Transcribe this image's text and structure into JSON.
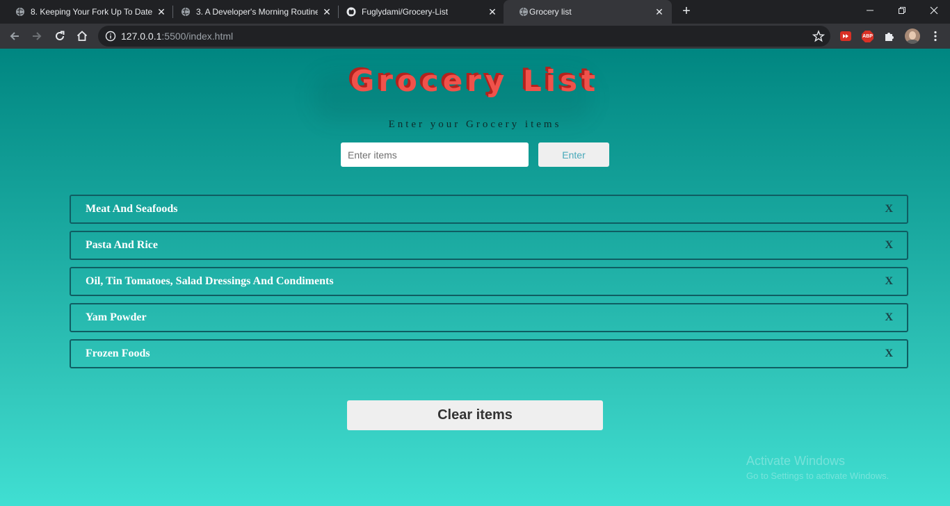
{
  "browser": {
    "tabs": [
      {
        "title": "8. Keeping Your Fork Up To Date",
        "icon": "globe-icon",
        "active": false
      },
      {
        "title": "3. A Developer's Morning Routine",
        "icon": "globe-icon",
        "active": false
      },
      {
        "title": "Fuglydami/Grocery-List",
        "icon": "github-icon",
        "active": false
      },
      {
        "title": "Grocery list",
        "icon": "globe-icon",
        "active": true
      }
    ],
    "new_tab": "+",
    "close_glyph": "✕",
    "address": {
      "host": "127.0.0.1",
      "rest": ":5500/index.html"
    },
    "extensions": [
      "video-extension-icon",
      "adblock-plus-icon",
      "extensions-puzzle-icon",
      "profile-avatar"
    ],
    "extension_labels": {
      "abp": "ABP"
    }
  },
  "app": {
    "title": "Grocery List",
    "subtitle": "Enter your Grocery items",
    "input_placeholder": "Enter items",
    "enter_label": "Enter",
    "items": [
      {
        "label": "Meat And Seafoods",
        "remove": "X"
      },
      {
        "label": "Pasta And Rice",
        "remove": "X"
      },
      {
        "label": "Oil, Tin Tomatoes, Salad Dressings And Condiments",
        "remove": "X"
      },
      {
        "label": "Yam Powder",
        "remove": "X"
      },
      {
        "label": "Frozen Foods",
        "remove": "X"
      }
    ],
    "clear_label": "Clear items"
  },
  "watermark": {
    "line1": "Activate Windows",
    "line2": "Go to Settings to activate Windows."
  },
  "colors": {
    "title": "#f0524b",
    "title_shadow": "#b3221d",
    "item_border": "#0f5d62",
    "page_gradient_top": "#008681",
    "page_gradient_bottom": "#40dfd2"
  }
}
